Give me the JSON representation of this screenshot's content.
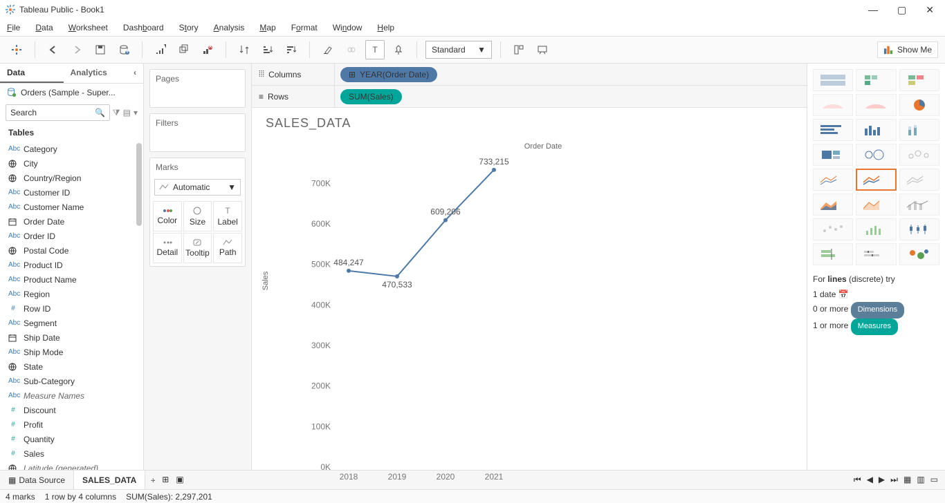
{
  "window_title": "Tableau Public - Book1",
  "menus": [
    "File",
    "Data",
    "Worksheet",
    "Dashboard",
    "Story",
    "Analysis",
    "Map",
    "Format",
    "Window",
    "Help"
  ],
  "menu_underlines": [
    0,
    0,
    0,
    4,
    0,
    0,
    0,
    3,
    0,
    0
  ],
  "fit_mode": "Standard",
  "showme_label": "Show Me",
  "sidebar": {
    "tab_data": "Data",
    "tab_analytics": "Analytics",
    "datasource": "Orders (Sample - Super...",
    "search_placeholder": "Search",
    "tables_header": "Tables",
    "fields": [
      {
        "icon": "Abc",
        "label": "Category"
      },
      {
        "icon": "globe",
        "label": "City"
      },
      {
        "icon": "globe",
        "label": "Country/Region"
      },
      {
        "icon": "Abc",
        "label": "Customer ID"
      },
      {
        "icon": "Abc",
        "label": "Customer Name"
      },
      {
        "icon": "cal",
        "label": "Order Date"
      },
      {
        "icon": "Abc",
        "label": "Order ID"
      },
      {
        "icon": "globe",
        "label": "Postal Code"
      },
      {
        "icon": "Abc",
        "label": "Product ID"
      },
      {
        "icon": "Abc",
        "label": "Product Name"
      },
      {
        "icon": "Abc",
        "label": "Region"
      },
      {
        "icon": "#",
        "label": "Row ID"
      },
      {
        "icon": "Abc",
        "label": "Segment"
      },
      {
        "icon": "cal",
        "label": "Ship Date"
      },
      {
        "icon": "Abc",
        "label": "Ship Mode"
      },
      {
        "icon": "globe",
        "label": "State"
      },
      {
        "icon": "Abc",
        "label": "Sub-Category"
      },
      {
        "icon": "Abc",
        "label": "Measure Names",
        "italic": true
      },
      {
        "icon": "#",
        "label": "Discount",
        "green": true
      },
      {
        "icon": "#",
        "label": "Profit",
        "green": true
      },
      {
        "icon": "#",
        "label": "Quantity",
        "green": true
      },
      {
        "icon": "#",
        "label": "Sales",
        "green": true
      },
      {
        "icon": "globe",
        "label": "Latitude (generated)",
        "italic": true,
        "green": true
      }
    ]
  },
  "shelves": {
    "pages": "Pages",
    "filters": "Filters",
    "marks": "Marks",
    "mark_type": "Automatic",
    "cells": [
      "Color",
      "Size",
      "Label",
      "Detail",
      "Tooltip",
      "Path"
    ]
  },
  "colrow": {
    "columns_label": "Columns",
    "rows_label": "Rows",
    "col_pill": "YEAR(Order Date)",
    "row_pill": "SUM(Sales)"
  },
  "chart_title": "SALES_DATA",
  "chart_data": {
    "type": "line",
    "title": "SALES_DATA",
    "xlabel": "Order Date",
    "ylabel": "Sales",
    "categories": [
      "2018",
      "2019",
      "2020",
      "2021"
    ],
    "values": [
      484247,
      470533,
      609206,
      733215
    ],
    "value_labels": [
      "484,247",
      "470,533",
      "609,206",
      "733,215"
    ],
    "yticks": [
      "0K",
      "100K",
      "200K",
      "300K",
      "400K",
      "500K",
      "600K",
      "700K"
    ],
    "ylim": [
      0,
      750000
    ]
  },
  "showme": {
    "hint_prefix": "For ",
    "hint_bold": "lines",
    "hint_suffix": " (discrete) try",
    "line1": "1 date",
    "line2": "0 or more",
    "badge_dim": "Dimensions",
    "line3": "1 or more",
    "badge_mea": "Measures"
  },
  "bottom": {
    "datasource": "Data Source",
    "sheet": "SALES_DATA"
  },
  "status": {
    "marks": "4 marks",
    "rows": "1 row by 4 columns",
    "sum": "SUM(Sales): 2,297,201"
  }
}
